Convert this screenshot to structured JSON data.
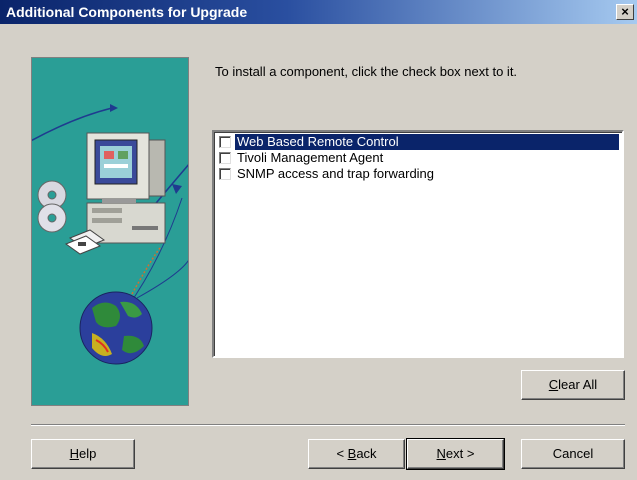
{
  "window": {
    "title": "Additional Components for Upgrade",
    "close_glyph": "×"
  },
  "instruction": "To install a component, click the check box next to it.",
  "components": [
    {
      "label": "Web Based Remote Control",
      "checked": false,
      "selected": true
    },
    {
      "label": "Tivoli Management Agent",
      "checked": false,
      "selected": false
    },
    {
      "label": "SNMP access and trap forwarding",
      "checked": false,
      "selected": false
    }
  ],
  "buttons": {
    "clear_all": {
      "accel": "C",
      "rest": "lear All"
    },
    "help": {
      "accel": "H",
      "rest": "elp"
    },
    "back": {
      "prefix": "< ",
      "accel": "B",
      "rest": "ack"
    },
    "next": {
      "accel": "N",
      "rest": "ext >"
    },
    "cancel": "Cancel"
  },
  "illustration": {
    "icons": [
      "computer-icon",
      "cd-icon",
      "floppy-disk-icon",
      "globe-icon"
    ]
  },
  "colors": {
    "title_start": "#0a246a",
    "title_end": "#a6caf0",
    "panel_bg": "#2a9e96",
    "selection": "#0a246a",
    "dialog_bg": "#d4d0c8"
  }
}
